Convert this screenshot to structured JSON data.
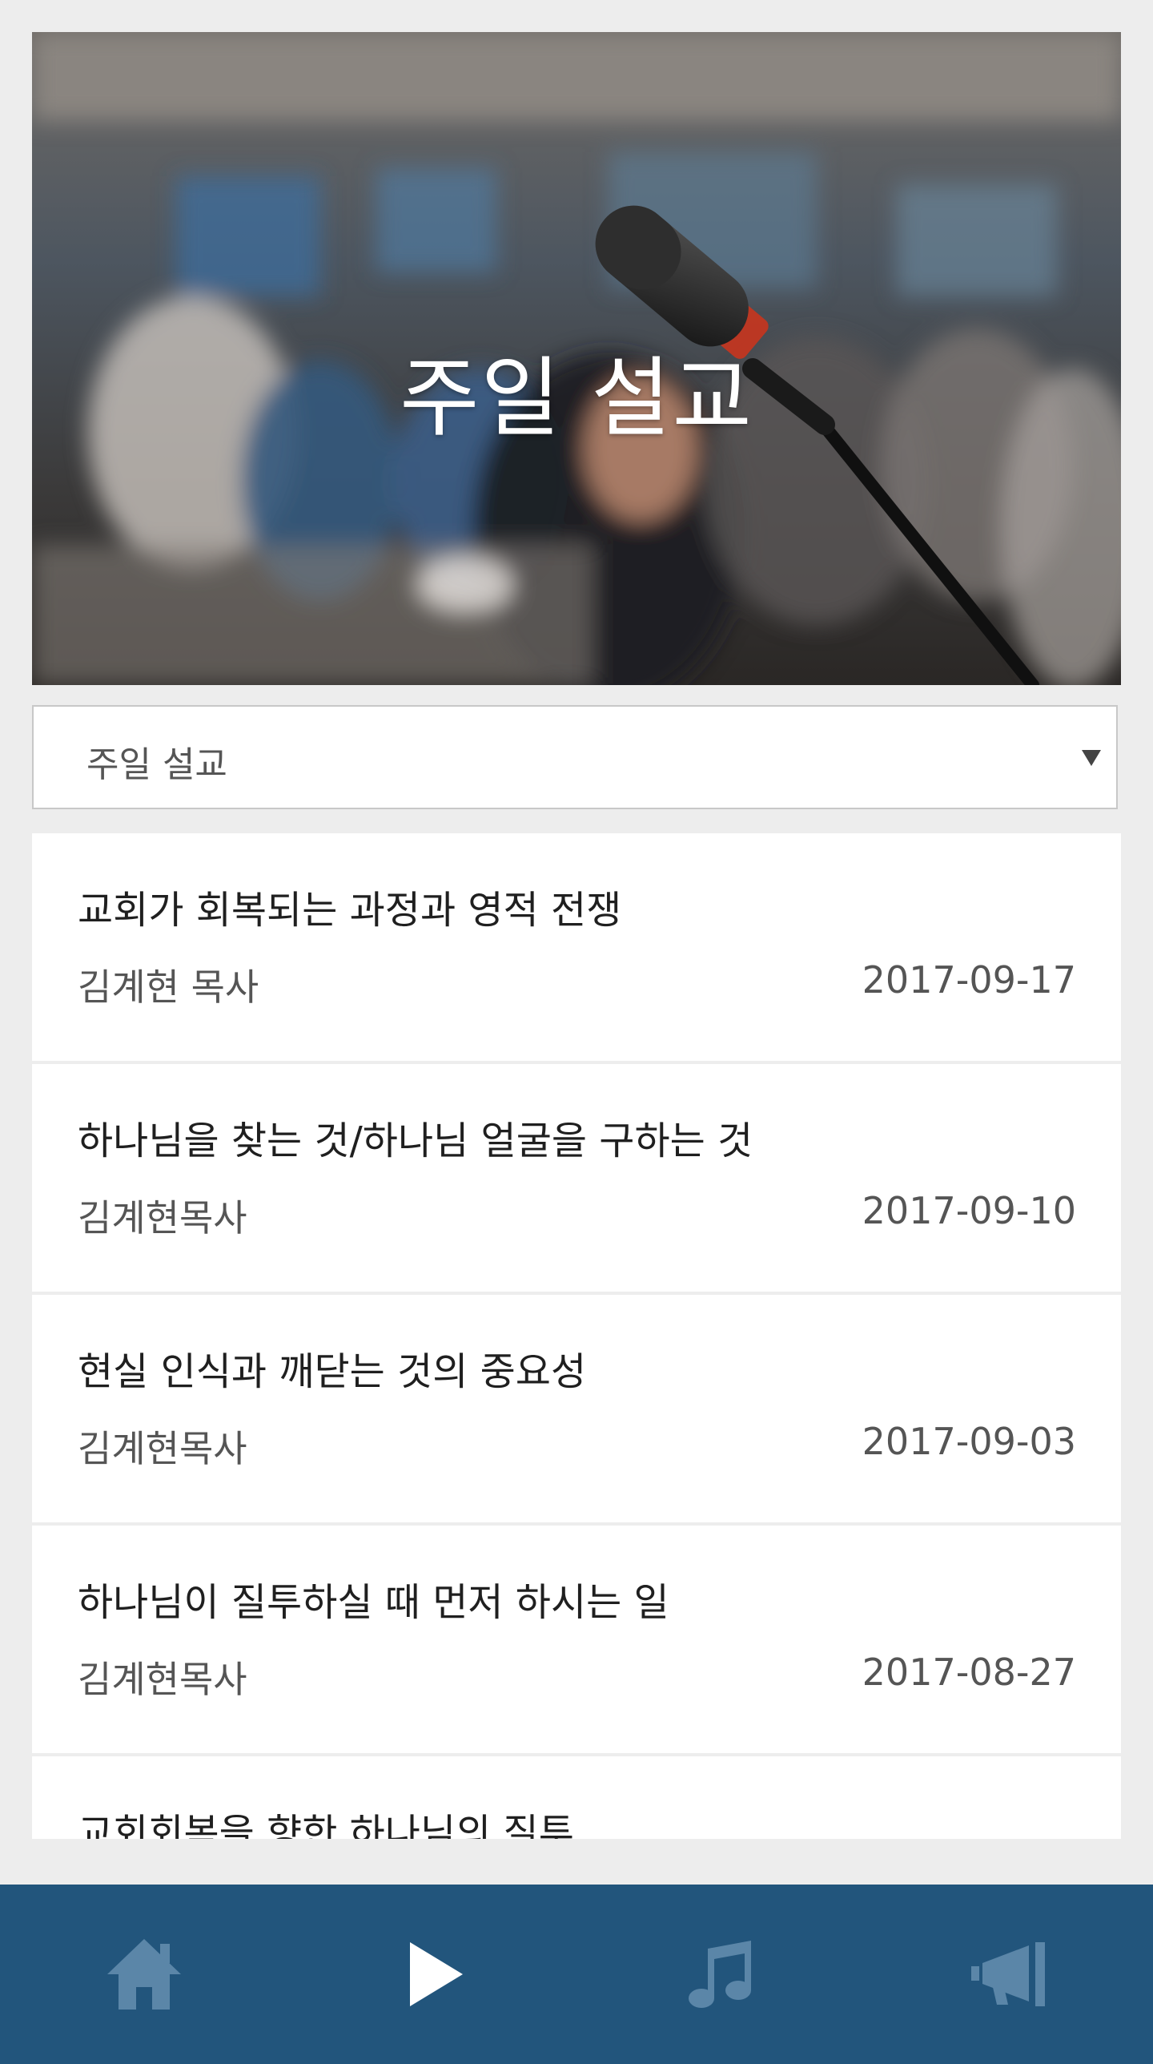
{
  "header": {
    "title": "주일 설교",
    "image_desc": "conference-microphone-photo"
  },
  "category_select": {
    "selected": "주일 설교"
  },
  "sermons": [
    {
      "title": "교회가 회복되는 과정과 영적 전쟁",
      "author": "김계현 목사",
      "date": "2017-09-17"
    },
    {
      "title": "하나님을 찾는 것/하나님 얼굴을 구하는 것",
      "author": "김계현목사",
      "date": "2017-09-10"
    },
    {
      "title": "현실 인식과 깨닫는 것의 중요성",
      "author": "김계현목사",
      "date": "2017-09-03"
    },
    {
      "title": "하나님이 질투하실 때 먼저 하시는 일",
      "author": "김계현목사",
      "date": "2017-08-27"
    },
    {
      "title": "교회회복을 향한 하나님의 질투",
      "author": "",
      "date": ""
    }
  ],
  "tabbar": {
    "tabs": [
      {
        "icon": "home-icon",
        "active": false
      },
      {
        "icon": "play-icon",
        "active": true
      },
      {
        "icon": "music-note-icon",
        "active": false
      },
      {
        "icon": "megaphone-icon",
        "active": false
      }
    ]
  },
  "colors": {
    "tabbar_bg": "#22557c",
    "tab_active": "#ffffff",
    "tab_inactive": "#5b86a8",
    "page_bg": "#ededed"
  }
}
